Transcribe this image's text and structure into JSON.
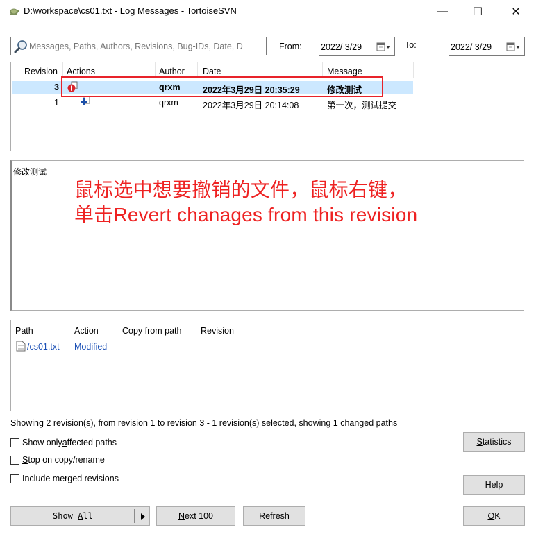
{
  "window": {
    "title": "D:\\workspace\\cs01.txt - Log Messages - TortoiseSVN",
    "minimize": "—",
    "maximize": "☐",
    "close": "✕"
  },
  "filter": {
    "search_placeholder": "Messages, Paths, Authors, Revisions, Bug-IDs, Date, D",
    "from_label": "From:",
    "from_date": "2022/  3/29",
    "to_label": "To:",
    "to_date": "2022/  3/29"
  },
  "revisions": {
    "headers": [
      "Revision",
      "Actions",
      "Author",
      "Date",
      "Message"
    ],
    "rows": [
      {
        "revision": "3",
        "author": "qrxm",
        "date": "2022年3月29日 20:35:29",
        "message": "修改测试",
        "selected": true
      },
      {
        "revision": "1",
        "author": "qrxm",
        "date": "2022年3月29日 20:14:08",
        "message": "第一次，测试提交",
        "selected": false
      }
    ]
  },
  "message_panel": {
    "text": "修改测试",
    "annotation_line1": "鼠标选中想要撤销的文件，鼠标右键，",
    "annotation_line2": "单击Revert chanages from this revision"
  },
  "paths": {
    "headers": [
      "Path",
      "Action",
      "Copy from path",
      "Revision"
    ],
    "rows": [
      {
        "path": "/cs01.txt",
        "action": "Modified"
      }
    ]
  },
  "status": "Showing 2 revision(s), from revision 1 to revision 3 - 1 revision(s) selected, showing 1 changed paths",
  "options": {
    "affected_pre": "Show only ",
    "affected_u": "a",
    "affected_post": "ffected paths",
    "stop_u": "S",
    "stop_post": "top on copy/rename",
    "merged": "Include merged revisions"
  },
  "buttons": {
    "statistics_u": "S",
    "statistics_post": "tatistics",
    "help": "Help",
    "show_all_pre": "Show ",
    "show_all_u": "A",
    "show_all_post": "ll",
    "next_u": "N",
    "next_post": "ext 100",
    "refresh": "Refresh",
    "ok_u": "O",
    "ok_post": "K"
  },
  "colors": {
    "selection": "#cce8ff",
    "annotation": "#ee2222",
    "highlight_box": "#e8232a",
    "link": "#1a4fb5"
  }
}
